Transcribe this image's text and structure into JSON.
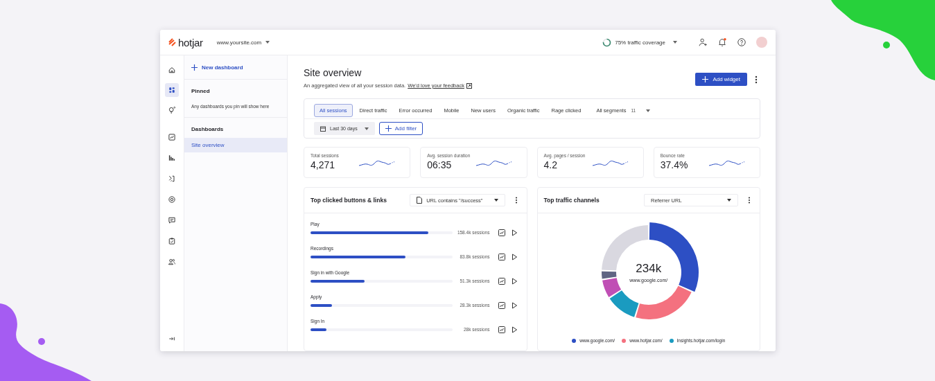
{
  "header": {
    "logo": "hotjar",
    "site": "www.yoursite.com",
    "coverage": {
      "label": "75% traffic coverage"
    }
  },
  "rail": {
    "primary": [
      {
        "kind": "home",
        "selected": false
      },
      {
        "kind": "dashboards",
        "selected": true
      },
      {
        "kind": "bulb",
        "selected": false
      }
    ],
    "tools": [
      {
        "kind": "trend",
        "selected": false
      },
      {
        "kind": "bars",
        "selected": false
      },
      {
        "kind": "funnel",
        "selected": false
      },
      {
        "kind": "target",
        "selected": false
      },
      {
        "kind": "chat",
        "selected": false
      },
      {
        "kind": "survey",
        "selected": false
      },
      {
        "kind": "users",
        "selected": false
      }
    ],
    "footer": [
      {
        "kind": "collapse",
        "selected": false
      }
    ]
  },
  "sidebar": {
    "new_button": "New dashboard",
    "sections": [
      {
        "heading": "Pinned",
        "hint": "Any dashboards you pin will show here"
      },
      {
        "heading": "Dashboards",
        "items": [
          {
            "label": "Site overview",
            "selected": true
          }
        ]
      }
    ]
  },
  "main": {
    "title": "Site overview",
    "subtitle": "An aggregated view of all your session data.",
    "feedback_link": "We'd love your feedback",
    "add_widget": "Add widget",
    "segments": [
      {
        "label": "All sessions",
        "selected": true
      },
      {
        "label": "Direct traffic",
        "selected": false
      },
      {
        "label": "Error occurred",
        "selected": false
      },
      {
        "label": "Mobile",
        "selected": false
      },
      {
        "label": "New users",
        "selected": false
      },
      {
        "label": "Organic traffic",
        "selected": false
      },
      {
        "label": "Rage clicked",
        "selected": false
      }
    ],
    "all_segments": {
      "label": "All segments",
      "count": "11"
    },
    "date_range": "Last 30 days",
    "add_filter": "Add filter",
    "kpis": [
      {
        "label": "Total sessions",
        "value": "4,271"
      },
      {
        "label": "Avg. session duration",
        "value": "06:35"
      },
      {
        "label": "Avg. pages / session",
        "value": "4.2"
      },
      {
        "label": "Bounce rate",
        "value": "37.4%"
      }
    ],
    "clicks_widget": {
      "title": "Top clicked buttons & links",
      "filter": "URL contains \"/success\"",
      "rows": [
        {
          "label": "Play",
          "level": 0.83,
          "reading": "158.4k sessions"
        },
        {
          "label": "Recordings",
          "level": 0.67,
          "reading": "83.8k sessions"
        },
        {
          "label": "Sign in with Google",
          "level": 0.38,
          "reading": "51.3k sessions"
        },
        {
          "label": "Apply",
          "level": 0.15,
          "reading": "28.3k sessions"
        },
        {
          "label": "Sign In",
          "level": 0.11,
          "reading": "28k sessions"
        }
      ]
    },
    "traffic_widget": {
      "title": "Top traffic channels",
      "filter": "Referrer URL",
      "center_value": "234k",
      "center_label": "www.google.com/",
      "legend": [
        {
          "label": "www.google.com/",
          "color": "#2d4fc4"
        },
        {
          "label": "www.hotjar.com/",
          "color": "#f4717f"
        },
        {
          "label": "Insights.hotjar.com/login",
          "color": "#1a9bc0"
        }
      ]
    }
  }
}
